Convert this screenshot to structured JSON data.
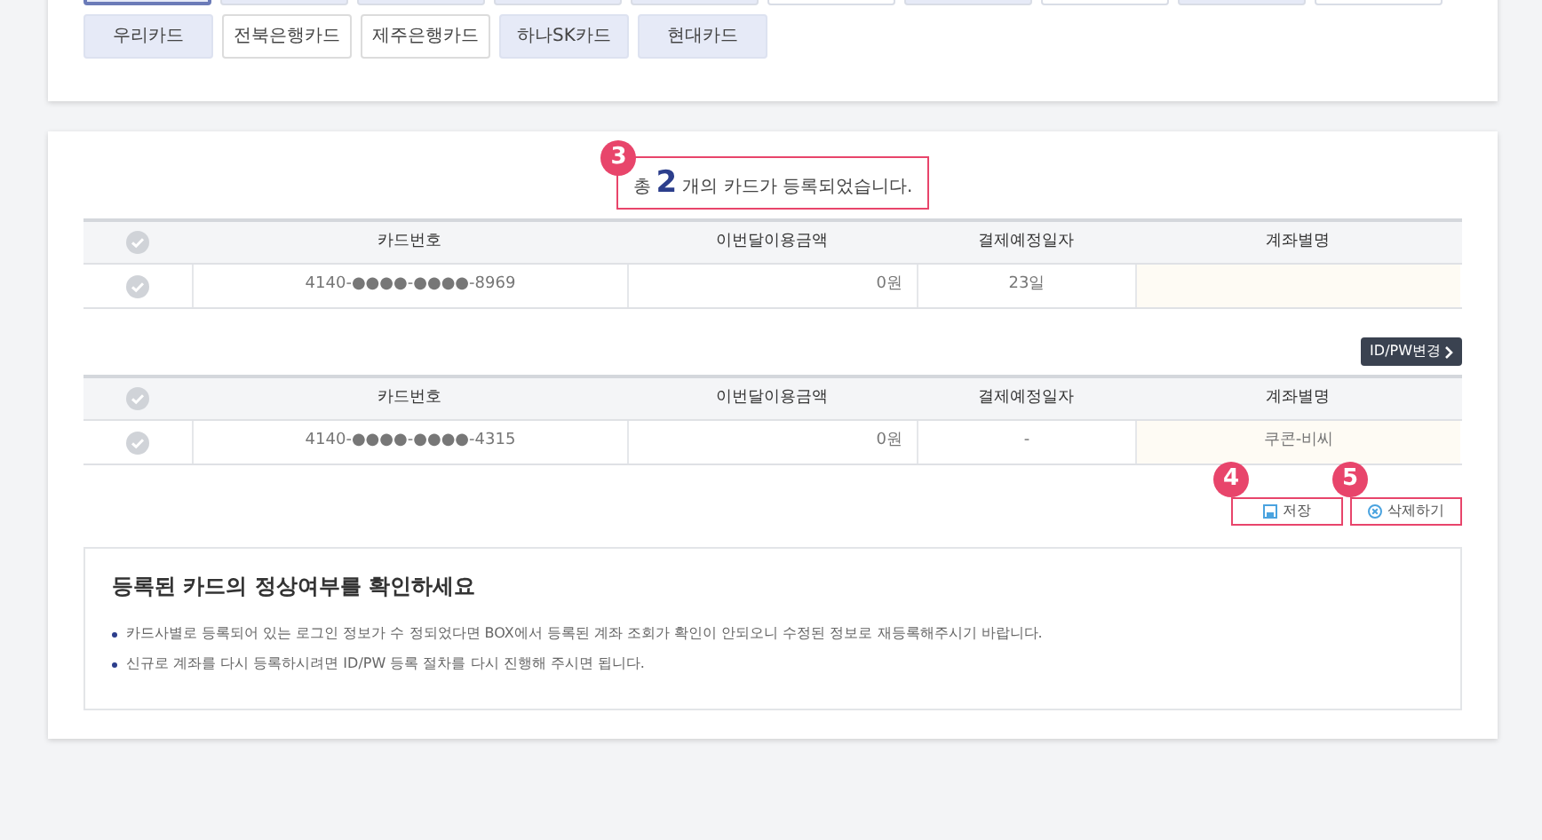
{
  "card_filter_row_1": [
    {
      "selected": true,
      "focused": true
    },
    {
      "selected": true,
      "focused": false
    },
    {
      "selected": true,
      "focused": false
    },
    {
      "selected": true,
      "focused": false
    },
    {
      "selected": true,
      "focused": false
    },
    {
      "selected": false,
      "focused": false
    },
    {
      "selected": true,
      "focused": false
    },
    {
      "selected": false,
      "focused": false
    },
    {
      "selected": true,
      "focused": false
    },
    {
      "selected": false,
      "focused": false
    }
  ],
  "card_filter_row_2": [
    {
      "label": "우리카드",
      "selected": true
    },
    {
      "label": "전북은행카드",
      "selected": false
    },
    {
      "label": "제주은행카드",
      "selected": false
    },
    {
      "label": "하나SK카드",
      "selected": true
    },
    {
      "label": "현대카드",
      "selected": true
    }
  ],
  "summary": {
    "step": "3",
    "prefix": "총",
    "count": "2",
    "suffix": "개의 카드가 등록되었습니다."
  },
  "tables": [
    {
      "columns": [
        "카드번호",
        "이번달이용금액",
        "결제예정일자",
        "계좌별명"
      ],
      "rows": [
        {
          "checked": false,
          "cells": [
            "4140-●●●●-●●●●-8969",
            "0원",
            "23일",
            ""
          ]
        }
      ]
    },
    {
      "action": "ID/PW변경",
      "columns": [
        "카드번호",
        "이번달이용금액",
        "결제예정일자",
        "계좌별명"
      ],
      "rows": [
        {
          "checked": false,
          "cells": [
            "4140-●●●●-●●●●-4315",
            "0원",
            "-",
            "쿠콘-비씨"
          ]
        }
      ]
    }
  ],
  "buttons": [
    {
      "step": "4",
      "label": "저장",
      "kind": "save"
    },
    {
      "step": "5",
      "label": "삭제하기",
      "kind": "delete"
    }
  ],
  "notice": {
    "title": "등록된 카드의 정상여부를 확인하세요",
    "items": [
      "카드사별로 등록되어 있는 로그인 정보가 수 정되었다면 BOX에서 등록된 계좌 조회가 확인이 안되오니 수정된 정보로 재등록해주시기 바랍니다.",
      "신규로 계좌를 다시 등록하시려면 ID/PW 등록 절차를 다시 진행해 주시면 됩니다."
    ]
  }
}
